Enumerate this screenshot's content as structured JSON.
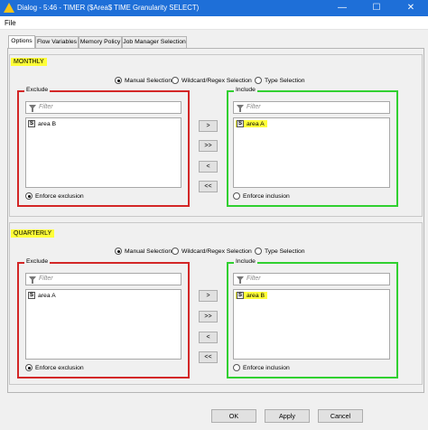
{
  "window": {
    "title": "Dialog - 5:46 - TIMER ($Area$ TIME Granularity SELECT)",
    "minimize_glyph": "—",
    "maximize_glyph": "☐",
    "close_glyph": "✕"
  },
  "menu": {
    "file": "File"
  },
  "tabs": [
    {
      "label": "Options"
    },
    {
      "label": "Flow Variables"
    },
    {
      "label": "Memory Policy"
    },
    {
      "label": "Job Manager Selection"
    }
  ],
  "sections": [
    {
      "title": "MONTHLY",
      "modes": {
        "manual": "Manual Selection",
        "wildcard": "Wildcard/Regex Selection",
        "type": "Type Selection",
        "selected": "manual"
      },
      "exclude": {
        "label": "Exclude",
        "filter_placeholder": "Filter",
        "items": [
          "area B"
        ],
        "enforce_label": "Enforce exclusion",
        "enforce_checked": true
      },
      "include": {
        "label": "Include",
        "filter_placeholder": "Filter",
        "items": [
          "area A"
        ],
        "enforce_label": "Enforce inclusion",
        "enforce_checked": false
      }
    },
    {
      "title": "QUARTERLY",
      "modes": {
        "manual": "Manual Selection",
        "wildcard": "Wildcard/Regex Selection",
        "type": "Type Selection",
        "selected": "manual"
      },
      "exclude": {
        "label": "Exclude",
        "filter_placeholder": "Filter",
        "items": [
          "area A"
        ],
        "enforce_label": "Enforce exclusion",
        "enforce_checked": true
      },
      "include": {
        "label": "Include",
        "filter_placeholder": "Filter",
        "items": [
          "area B"
        ],
        "enforce_label": "Enforce inclusion",
        "enforce_checked": false
      }
    }
  ],
  "column_type_badge": "S",
  "move_buttons": [
    ">",
    ">>",
    "<",
    "<<"
  ],
  "buttons": {
    "ok": "OK",
    "apply": "Apply",
    "cancel": "Cancel"
  },
  "colors": {
    "titlebar": "#1e6fd8",
    "highlight": "#ffff38",
    "exclude_border": "#d32626",
    "include_border": "#30d030"
  }
}
